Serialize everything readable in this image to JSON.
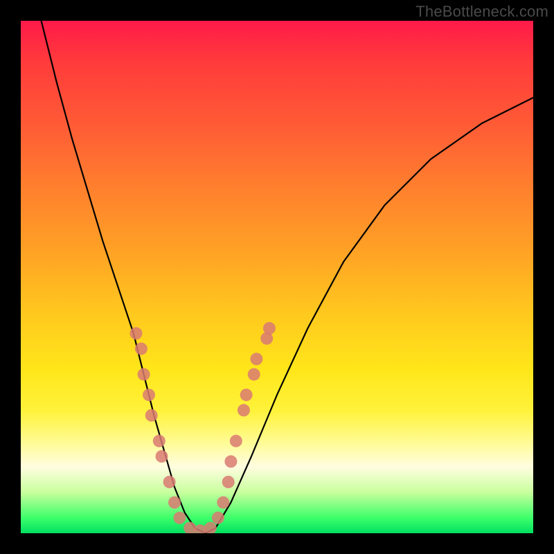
{
  "watermark": "TheBottleneck.com",
  "chart_data": {
    "type": "line",
    "title": "",
    "xlabel": "",
    "ylabel": "",
    "xlim": [
      0,
      100
    ],
    "ylim": [
      0,
      100
    ],
    "series": [
      {
        "name": "curve",
        "x": [
          4,
          7,
          10,
          13,
          16,
          19,
          22,
          24,
          26,
          28,
          30,
          32,
          34,
          36,
          38,
          41,
          45,
          50,
          56,
          63,
          71,
          80,
          90,
          100
        ],
        "y": [
          100,
          88,
          77,
          67,
          57,
          48,
          39,
          31,
          23,
          16,
          9,
          4,
          1,
          0,
          1,
          6,
          15,
          27,
          40,
          53,
          64,
          73,
          80,
          85
        ]
      }
    ],
    "markers": [
      {
        "x": 22.5,
        "y": 39
      },
      {
        "x": 23.5,
        "y": 36
      },
      {
        "x": 24.0,
        "y": 31
      },
      {
        "x": 25.0,
        "y": 27
      },
      {
        "x": 25.5,
        "y": 23
      },
      {
        "x": 27.0,
        "y": 18
      },
      {
        "x": 27.5,
        "y": 15
      },
      {
        "x": 29.0,
        "y": 10
      },
      {
        "x": 30.0,
        "y": 6
      },
      {
        "x": 31.0,
        "y": 3
      },
      {
        "x": 33.0,
        "y": 1
      },
      {
        "x": 35.0,
        "y": 0.5
      },
      {
        "x": 37.0,
        "y": 1
      },
      {
        "x": 38.5,
        "y": 3
      },
      {
        "x": 39.5,
        "y": 6
      },
      {
        "x": 40.5,
        "y": 10
      },
      {
        "x": 41.0,
        "y": 14
      },
      {
        "x": 42.0,
        "y": 18
      },
      {
        "x": 43.5,
        "y": 24
      },
      {
        "x": 44.0,
        "y": 27
      },
      {
        "x": 45.5,
        "y": 31
      },
      {
        "x": 46.0,
        "y": 34
      },
      {
        "x": 48.0,
        "y": 38
      },
      {
        "x": 48.5,
        "y": 40
      }
    ],
    "marker_color": "#d97a72",
    "curve_color": "#000000",
    "background_gradient": [
      "#ff1a4a",
      "#ff7e2e",
      "#ffe61a",
      "#fffde0",
      "#00e060"
    ]
  }
}
